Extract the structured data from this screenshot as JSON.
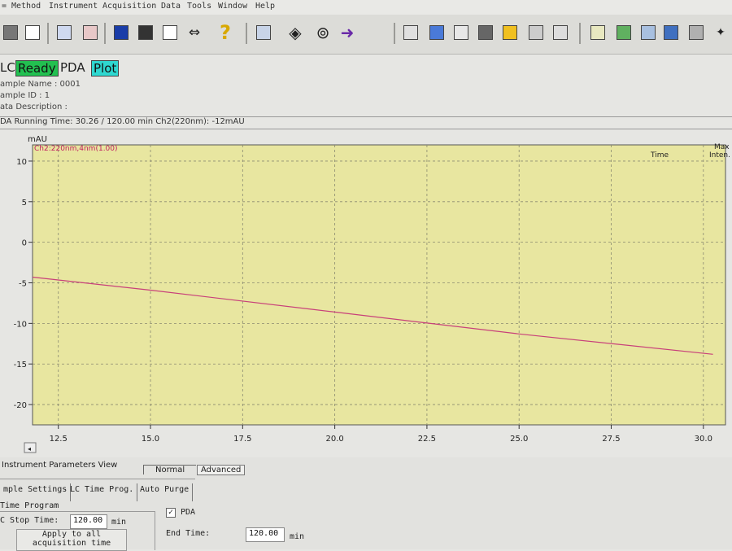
{
  "menu": {
    "method": "Method",
    "instrument": "Instrument",
    "acquisition": "Acquisition",
    "data": "Data",
    "tools": "Tools",
    "window": "Window",
    "help": "Help"
  },
  "toolbar": {
    "help_glyph": "?"
  },
  "status": {
    "lc_label": "LC",
    "ready_label": "Ready",
    "pda_label": "PDA",
    "plot_label": "Plot"
  },
  "sample": {
    "name_label": "ample Name : 0001",
    "id_label": "ample ID : 1",
    "description_label": "ata Description :"
  },
  "running_line": "DA Running Time: 30.26 / 120.00 min Ch2(220nm): -12mAU",
  "chart_data": {
    "type": "line",
    "ylabel": "mAU",
    "channel_label": "Ch2:220nm,4nm(1.00)",
    "time_label": "Time",
    "max_label": "Max",
    "inten_label": "Inten.",
    "xlim": [
      11.8,
      30.6
    ],
    "ylim": [
      -22.5,
      12
    ],
    "xticks": [
      "12.5",
      "15.0",
      "17.5",
      "20.0",
      "22.5",
      "25.0",
      "27.5",
      "30.0"
    ],
    "xtick_values": [
      12.5,
      15.0,
      17.5,
      20.0,
      22.5,
      25.0,
      27.5,
      30.0
    ],
    "yticks": [
      "10",
      "5",
      "0",
      "-5",
      "-10",
      "-15",
      "-20"
    ],
    "ytick_values": [
      10,
      5,
      0,
      -5,
      -10,
      -15,
      -20
    ],
    "grid": true,
    "series": [
      {
        "color": "#c8407a",
        "x": [
          11.8,
          15.0,
          20.0,
          25.0,
          30.26
        ],
        "y": [
          -4.3,
          -5.9,
          -8.6,
          -11.3,
          -13.8
        ]
      }
    ],
    "plot_bg": "#e8e6a0"
  },
  "params": {
    "view_title": "Instrument Parameters View",
    "normal_label": "Normal",
    "advanced_label": "Advanced",
    "tabs": [
      "mple Settings",
      "LC Time Prog.",
      "Auto Purge"
    ],
    "time_program_label": "Time Program",
    "stop_time_label": "C Stop Time:",
    "stop_time_value": "120.00",
    "min_unit": "min",
    "apply_line1": "Apply to all",
    "apply_line2": "acquisition time",
    "pda_check_label": "PDA",
    "end_time_label": "End Time:",
    "end_time_value": "120.00",
    "end_min_unit": "min"
  }
}
